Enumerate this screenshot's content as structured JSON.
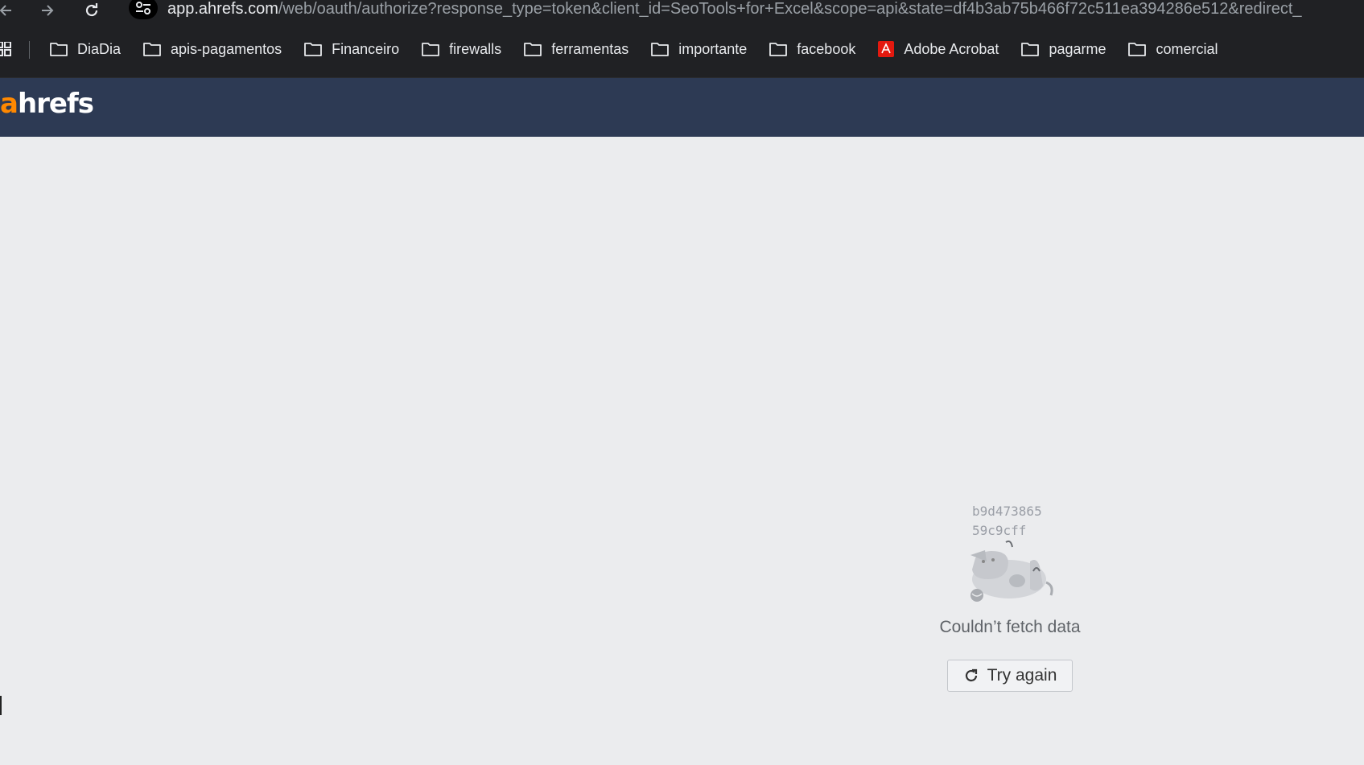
{
  "browser": {
    "url_host": "app.ahrefs.com",
    "url_rest": "/web/oauth/authorize?response_type=token&client_id=SeoTools+for+Excel&scope=api&state=df4b3ab75b466f72c511ea394286e512&redirect_",
    "bookmarks": [
      {
        "label": "DiaDia",
        "icon": "folder-icon"
      },
      {
        "label": "apis-pagamentos",
        "icon": "folder-icon"
      },
      {
        "label": "Financeiro",
        "icon": "folder-icon"
      },
      {
        "label": "firewalls",
        "icon": "folder-icon"
      },
      {
        "label": "ferramentas",
        "icon": "folder-icon"
      },
      {
        "label": "importante",
        "icon": "folder-icon"
      },
      {
        "label": "facebook",
        "icon": "folder-icon"
      },
      {
        "label": "Adobe Acrobat",
        "icon": "acrobat-icon"
      },
      {
        "label": "pagarme",
        "icon": "folder-icon"
      },
      {
        "label": "comercial",
        "icon": "folder-icon"
      }
    ]
  },
  "app": {
    "logo_accent": "a",
    "logo_rest": "hrefs",
    "accent_color": "#ff8800",
    "header_color": "#2d3a54"
  },
  "error": {
    "code_line1": "b9d473865",
    "code_line2": "59c9cff",
    "message": "Couldn’t fetch data",
    "retry_label": "Try again"
  }
}
